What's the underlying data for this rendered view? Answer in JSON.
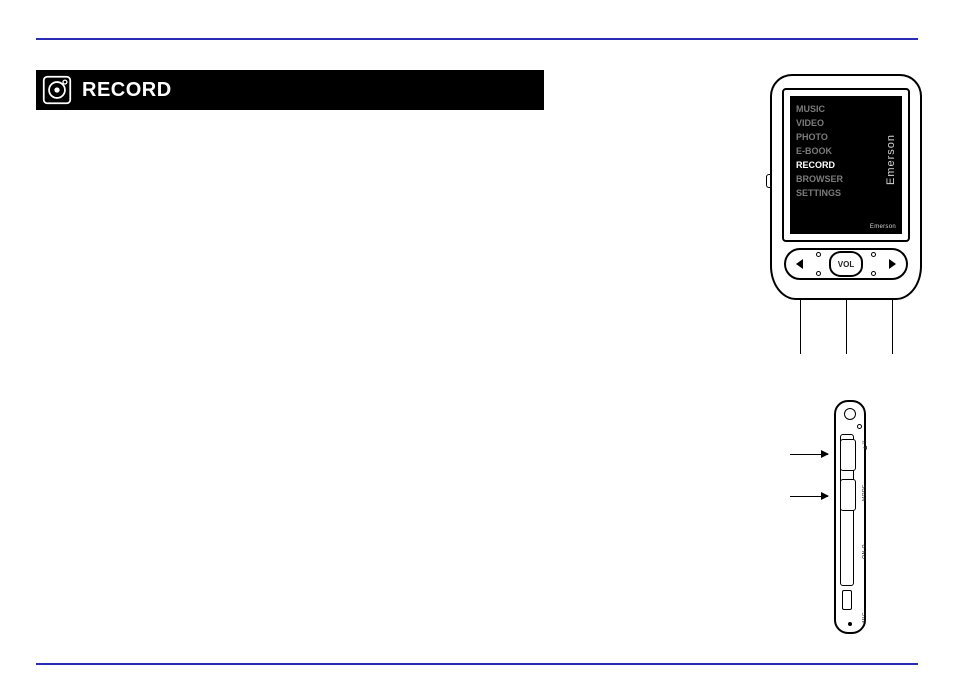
{
  "header": {
    "title": "RECORD",
    "icon_name": "record-icon"
  },
  "device_menu": {
    "items": [
      "MUSIC",
      "VIDEO",
      "PHOTO",
      "E-BOOK",
      "RECORD",
      "BROWSER",
      "SETTINGS"
    ],
    "active_index": 4,
    "brand": "Emerson",
    "brand_badge": "Emerson"
  },
  "front_controls": {
    "vol_label": "VOL",
    "callouts": {
      "left": "",
      "center": "",
      "right": ""
    }
  },
  "side_view": {
    "labels": {
      "play": "▶II",
      "mode": "MODE",
      "on": "ON O",
      "mic": "MIC"
    },
    "arrow_callouts": {
      "top": "",
      "bottom": ""
    }
  },
  "page_number": ""
}
